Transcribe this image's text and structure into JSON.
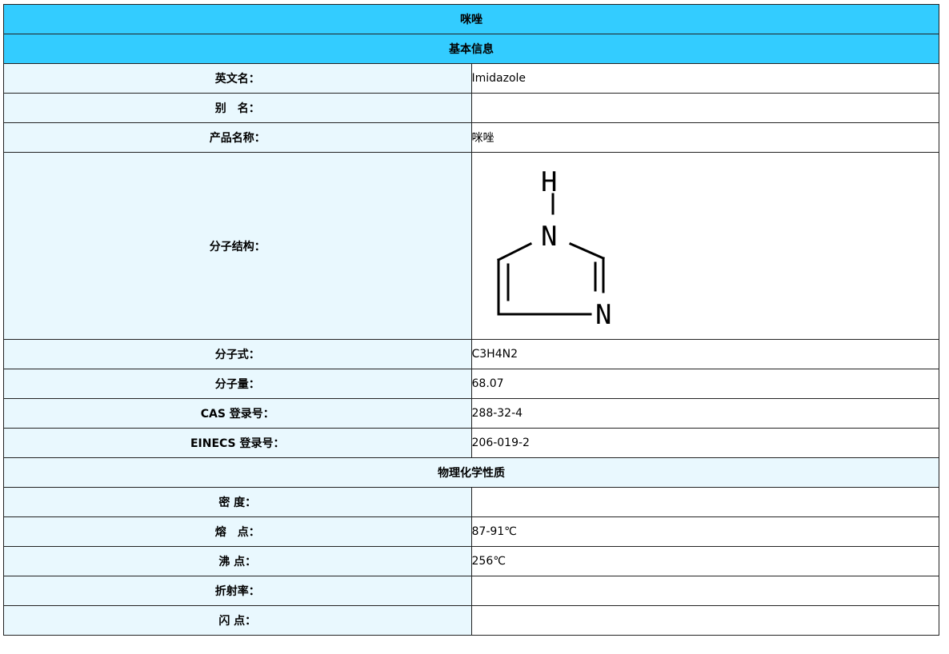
{
  "title": "咪唑",
  "section_basic": "基本信息",
  "basic_rows": [
    {
      "label": "英文名：",
      "value": "Imidazole"
    },
    {
      "label": "别　名：",
      "value": ""
    },
    {
      "label": "产品名称：",
      "value": "咪唑"
    }
  ],
  "structure": {
    "label": "分子结构：",
    "atoms": [
      "H",
      "N",
      "N"
    ]
  },
  "formula_rows": [
    {
      "label": "分子式：",
      "value": "C3H4N2"
    },
    {
      "label": "分子量：",
      "value": "68.07"
    },
    {
      "label": "CAS 登录号：",
      "value": "288-32-4"
    },
    {
      "label": "EINECS 登录号：",
      "value": "206-019-2"
    }
  ],
  "section_physchem": "物理化学性质",
  "physchem_rows": [
    {
      "label": "密 度：",
      "value": ""
    },
    {
      "label": "熔　点：",
      "value": "87-91℃"
    },
    {
      "label": "沸 点：",
      "value": "256℃"
    },
    {
      "label": "折射率：",
      "value": ""
    },
    {
      "label": "闪 点：",
      "value": ""
    }
  ]
}
